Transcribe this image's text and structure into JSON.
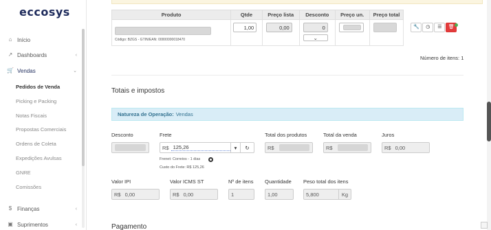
{
  "brand": "eccosys",
  "sidebar": {
    "items": [
      {
        "label": "Início",
        "icon": "home-icon"
      },
      {
        "label": "Dashboards",
        "icon": "chart-icon"
      },
      {
        "label": "Vendas",
        "icon": "cart-icon"
      }
    ],
    "sub_items": [
      "Pedidos de Venda",
      "Picking e Packing",
      "Notas Fiscais",
      "Propostas Comerciais",
      "Ordens de Coleta",
      "Expedições Avulsas",
      "GNRE",
      "Comissões"
    ],
    "bottom_items": [
      {
        "label": "Finanças",
        "icon": "dollar-icon"
      },
      {
        "label": "Suprimentos",
        "icon": "box-icon"
      }
    ]
  },
  "products_table": {
    "headers": [
      "Produto",
      "Qtde",
      "Preço lista",
      "Desconto",
      "Preço un.",
      "Preço total"
    ],
    "row": {
      "code_label": "Código: BZGS - GTIN/EAN: 00000000018470",
      "qty": "1,00",
      "list_price": "0,00",
      "discount": "0"
    }
  },
  "num_items": "Número de itens: 1",
  "totals": {
    "title": "Totais e impostos",
    "natureza_label": "Natureza de Operação:",
    "natureza_value": "Vendas",
    "desconto_label": "Desconto",
    "frete_label": "Frete",
    "frete_prefix": "R$",
    "frete_value": "125,26",
    "frenet_note": "Frenet: Correios - 1 dias",
    "custo_frete": "Custo do Frete: R$ 125,26",
    "total_produtos_label": "Total dos produtos",
    "total_venda_label": "Total da venda",
    "juros_label": "Juros",
    "juros_value": "0,00",
    "currency": "R$",
    "ipi_label": "Valor IPI",
    "ipi_value": "0,00",
    "icms_label": "Valor ICMS ST",
    "icms_value": "0,00",
    "itens_label": "Nº de itens",
    "itens_value": "1",
    "quantidade_label": "Quantidade",
    "quantidade_value": "1,00",
    "peso_label": "Peso total dos itens",
    "peso_value": "5,800",
    "peso_unit": "Kg"
  },
  "pagamento_title": "Pagamento"
}
